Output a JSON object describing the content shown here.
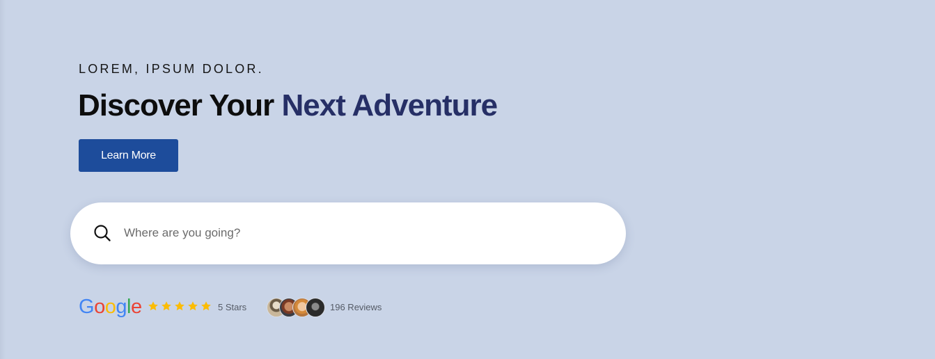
{
  "hero": {
    "eyebrow": "LOREM, IPSUM DOLOR.",
    "headline_part1": "Discover Your",
    "headline_part2": "Next Adventure",
    "cta_label": "Learn More"
  },
  "search": {
    "placeholder": "Where are you going?",
    "value": ""
  },
  "rating": {
    "provider_letters": [
      "G",
      "o",
      "o",
      "g",
      "l",
      "e"
    ],
    "stars": 5,
    "stars_label": "5 Stars",
    "avatar_count": 4,
    "reviews_label": "196 Reviews"
  },
  "colors": {
    "background": "#c9d4e7",
    "headline_accent": "#262f66",
    "button": "#1d4c9b",
    "star": "#fbbc05"
  },
  "icons": {
    "search": "search-icon",
    "star": "star-icon"
  }
}
